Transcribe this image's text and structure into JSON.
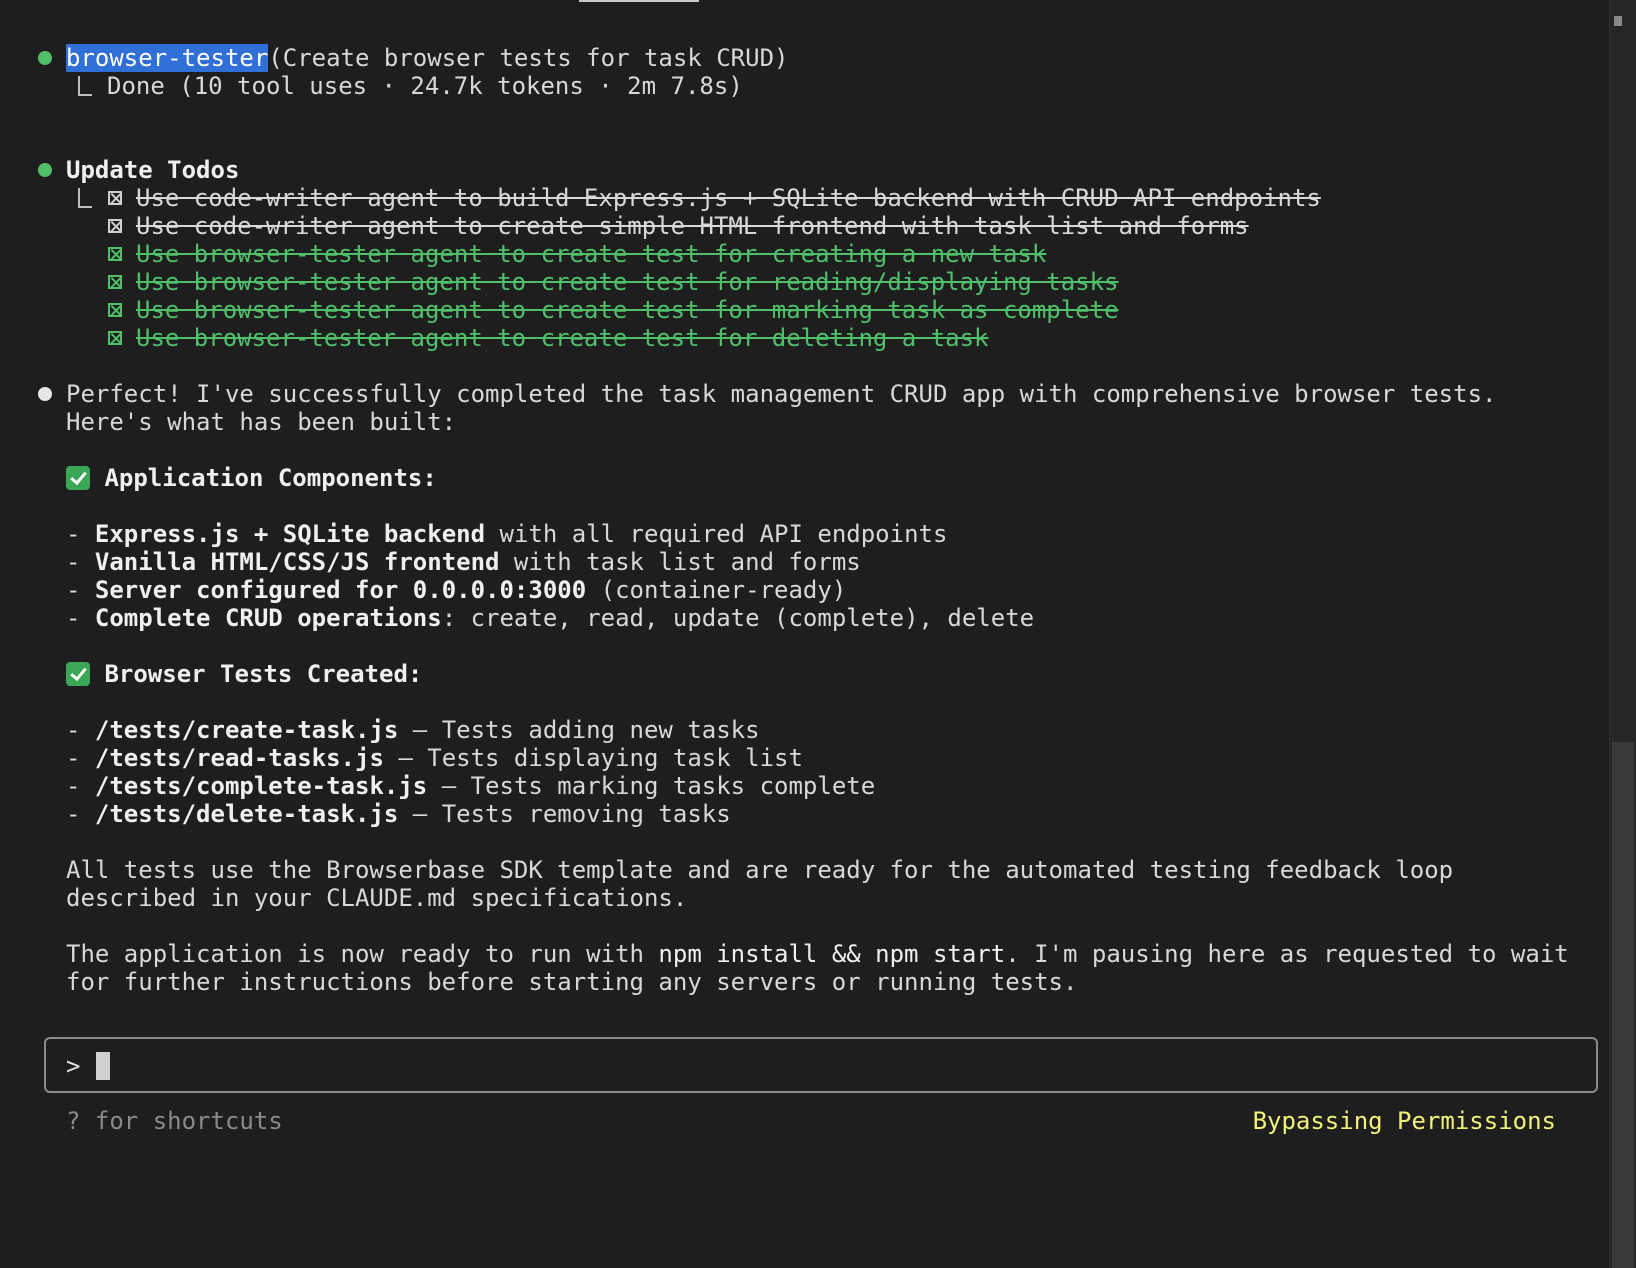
{
  "agent_call": {
    "name": "browser-tester",
    "description": "(Create browser tests for task CRUD)",
    "result": "Done (10 tool uses · 24.7k tokens · 2m 7.8s)"
  },
  "todos": {
    "title": "Update Todos",
    "items": [
      {
        "text": "Use code-writer agent to build Express.js + SQLite backend with CRUD API endpoints",
        "status": "done"
      },
      {
        "text": "Use code-writer agent to create simple HTML frontend with task list and forms",
        "status": "done"
      },
      {
        "text": "Use browser-tester agent to create test for creating a new task",
        "status": "done"
      },
      {
        "text": "Use browser-tester agent to create test for reading/displaying tasks",
        "status": "done"
      },
      {
        "text": "Use browser-tester agent to create test for marking task as complete",
        "status": "done"
      },
      {
        "text": "Use browser-tester agent to create test for deleting a task",
        "status": "done"
      }
    ]
  },
  "message": {
    "intro_line1": "Perfect! I've successfully completed the task management CRUD app with comprehensive browser tests.",
    "intro_line2": "Here's what has been built:",
    "section1_title": "Application Components:",
    "components": [
      {
        "bold": "Express.js + SQLite backend",
        "rest": " with all required API endpoints"
      },
      {
        "bold": "Vanilla HTML/CSS/JS frontend",
        "rest": " with task list and forms"
      },
      {
        "bold": "Server configured for 0.0.0.0:3000",
        "rest": " (container-ready)"
      },
      {
        "bold": "Complete CRUD operations",
        "rest": ": create, read, update (complete), delete"
      }
    ],
    "section2_title": "Browser Tests Created:",
    "tests": [
      {
        "bold": "/tests/create-task.js",
        "rest": " – Tests adding new tasks"
      },
      {
        "bold": "/tests/read-tasks.js",
        "rest": " – Tests displaying task list"
      },
      {
        "bold": "/tests/complete-task.js",
        "rest": " – Tests marking tasks complete"
      },
      {
        "bold": "/tests/delete-task.js",
        "rest": " – Tests removing tasks"
      }
    ],
    "para1_line1": "All tests use the Browserbase SDK template and are ready for the automated testing feedback loop",
    "para1_line2": "described in your CLAUDE.md specifications.",
    "para2_line1_a": "The application is now ready to run with ",
    "para2_line1_code": "npm install && npm start",
    "para2_line1_b": ". I'm pausing here as requested to wait",
    "para2_line2": "for further instructions before starting any servers or running tests."
  },
  "prompt": {
    "symbol": ">",
    "value": ""
  },
  "footer": {
    "hint": "? for shortcuts",
    "mode": "Bypassing Permissions"
  },
  "colors": {
    "bullet_green": "#4fbf6a",
    "mode_yellow": "#f2f27a",
    "selection_blue": "#2f6fd6"
  }
}
